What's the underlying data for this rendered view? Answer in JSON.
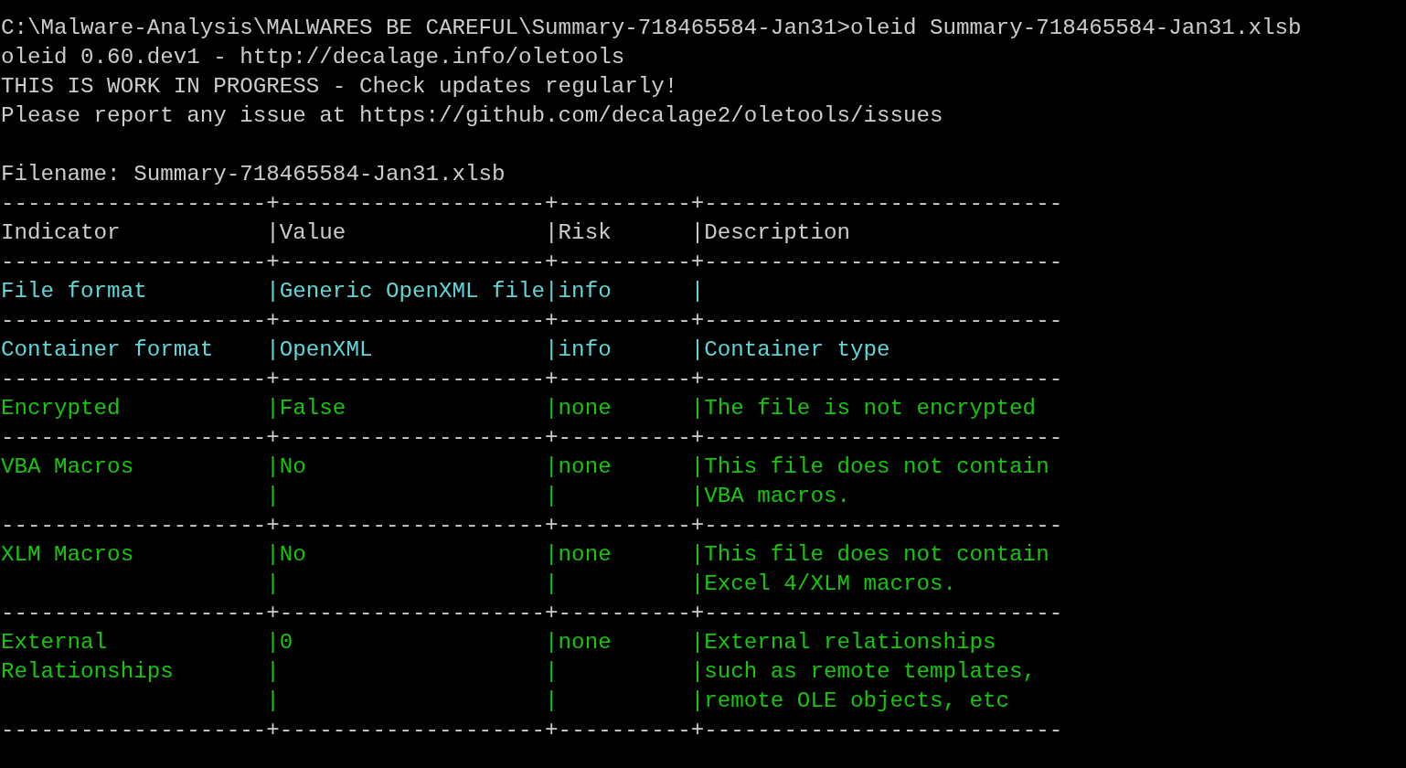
{
  "terminal": {
    "lines": [
      {
        "text": "C:\\Malware-Analysis\\MALWARES BE CAREFUL\\Summary-718465584-Jan31>oleid Summary-718465584-Jan31.xlsb"
      },
      {
        "text": "oleid 0.60.dev1 - http://decalage.info/oletools"
      },
      {
        "text": "THIS IS WORK IN PROGRESS - Check updates regularly!"
      },
      {
        "text": "Please report any issue at https://github.com/decalage2/oletools/issues"
      },
      {
        "blank_before": true,
        "text": "Filename: Summary-718465584-Jan31.xlsb"
      }
    ],
    "table": {
      "top_rule": "--------------------+--------------------+----------+---------------------------",
      "header": {
        "cells": [
          [
            "Indicator"
          ],
          [
            "|Value"
          ],
          [
            "|Risk"
          ],
          [
            "|Description"
          ]
        ]
      },
      "rows": [
        {
          "rule_above": "--------------------+--------------------+----------+---------------------------",
          "color": "#61d6d6",
          "cells": [
            [
              "File format"
            ],
            [
              "|Generic OpenXML file"
            ],
            [
              "|info"
            ],
            [
              "|"
            ]
          ]
        },
        {
          "rule_above": "--------------------+--------------------+----------+---------------------------",
          "color": "#61d6d6",
          "cells": [
            [
              "Container format"
            ],
            [
              "|OpenXML"
            ],
            [
              "|info"
            ],
            [
              "|Container type"
            ]
          ]
        },
        {
          "rule_above": "--------------------+--------------------+----------+---------------------------",
          "color": "#16c60c",
          "cells": [
            [
              "Encrypted"
            ],
            [
              "|False"
            ],
            [
              "|none"
            ],
            [
              "|The file is not encrypted"
            ]
          ]
        },
        {
          "rule_above": "--------------------+--------------------+----------+---------------------------",
          "color": "#16c60c",
          "cells": [
            [
              "VBA Macros"
            ],
            [
              "|No",
              "|"
            ],
            [
              "|none",
              "|"
            ],
            [
              "|This file does not contain",
              "|VBA macros."
            ]
          ]
        },
        {
          "rule_above": "--------------------+--------------------+----------+---------------------------",
          "color": "#16c60c",
          "cells": [
            [
              "XLM Macros"
            ],
            [
              "|No",
              "|"
            ],
            [
              "|none",
              "|"
            ],
            [
              "|This file does not contain",
              "|Excel 4/XLM macros."
            ]
          ]
        },
        {
          "rule_above": "--------------------+--------------------+----------+---------------------------",
          "color": "#16c60c",
          "cells": [
            [
              "External",
              "Relationships"
            ],
            [
              "|0",
              "|",
              "|"
            ],
            [
              "|none",
              "|",
              "|"
            ],
            [
              "|External relationships",
              "|such as remote templates,",
              "|remote OLE objects, etc"
            ]
          ]
        }
      ],
      "bottom_rule": "--------------------+--------------------+----------+---------------------------"
    }
  }
}
